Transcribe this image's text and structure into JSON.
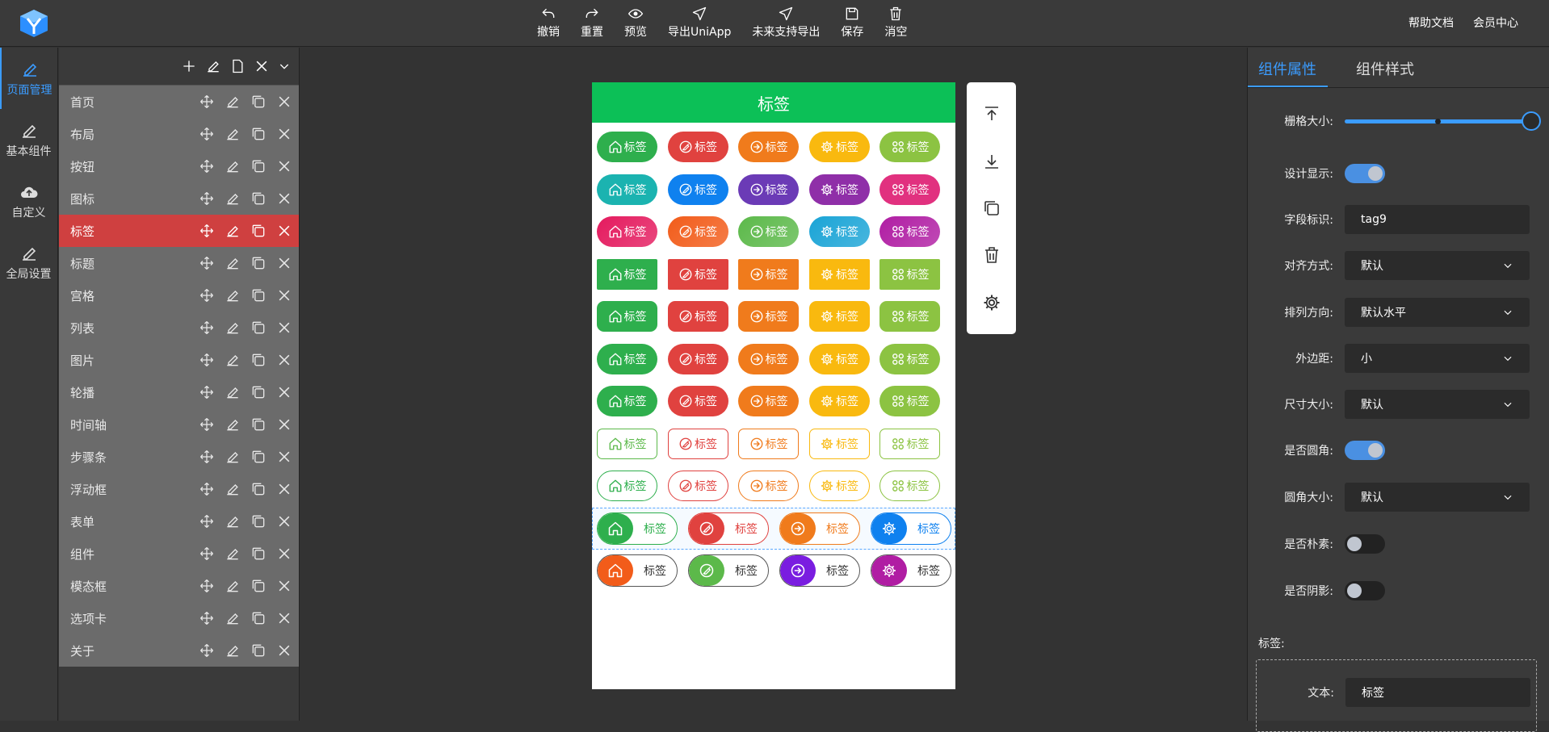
{
  "topbar": {
    "buttons": [
      {
        "label": "撤销",
        "icon": "undo-icon"
      },
      {
        "label": "重置",
        "icon": "redo-icon"
      },
      {
        "label": "预览",
        "icon": "eye-icon"
      },
      {
        "label": "导出UniApp",
        "icon": "send-icon"
      },
      {
        "label": "未来支持导出",
        "icon": "send-icon"
      },
      {
        "label": "保存",
        "icon": "save-icon"
      },
      {
        "label": "消空",
        "icon": "trash-icon"
      }
    ],
    "right_links": [
      "帮助文档",
      "会员中心"
    ]
  },
  "left_rail": {
    "items": [
      {
        "label": "页面管理",
        "icon": "edit-icon",
        "active": true
      },
      {
        "label": "基本组件",
        "icon": "edit-icon",
        "active": false
      },
      {
        "label": "自定义",
        "icon": "cloud-upload-icon",
        "active": false
      },
      {
        "label": "全局设置",
        "icon": "edit-icon",
        "active": false
      }
    ]
  },
  "page_panel": {
    "pages": [
      "首页",
      "布局",
      "按钮",
      "图标",
      "标签",
      "标题",
      "宫格",
      "列表",
      "图片",
      "轮播",
      "时间轴",
      "步骤条",
      "浮动框",
      "表单",
      "组件",
      "模态框",
      "选项卡",
      "关于"
    ],
    "active_index": 4
  },
  "canvas": {
    "title": "标签",
    "tag_label": "标签",
    "icons": [
      "home-icon",
      "no-edit-icon",
      "arrow-right-circle-icon",
      "gear-icon",
      "apps-icon"
    ],
    "row_colors": [
      [
        "#2eaf4d",
        "#e0423f",
        "#f07b1c",
        "#f9b90f",
        "#8cc342"
      ],
      [
        "#1bb3b0",
        "#0f81ef",
        "#6b3bb6",
        "#8f2fa8",
        "#e1317f"
      ],
      [
        "#e41a5e",
        "#f25c1a",
        "#5cb94a",
        "#1aa4d6",
        "#b01da3"
      ],
      [
        "#2eaf4d",
        "#e0423f",
        "#f07b1c",
        "#f9b90f",
        "#8cc342"
      ],
      [
        "#2eaf4d",
        "#e0423f",
        "#f07b1c",
        "#f9b90f",
        "#8cc342"
      ],
      [
        "#2eaf4d",
        "#e0423f",
        "#f07b1c",
        "#f9b90f",
        "#8cc342"
      ],
      [
        "#2eaf4d",
        "#e0423f",
        "#f07b1c",
        "#f9b90f",
        "#8cc342"
      ],
      [
        "#5cb94a",
        "#e0423f",
        "#f07b1c",
        "#f9b90f",
        "#8cc342"
      ],
      [
        "#2eaf4d",
        "#e0423f",
        "#f07b1c",
        "#f9b90f",
        "#8cc342"
      ]
    ],
    "split_row_1": {
      "icons": [
        "home-icon",
        "no-edit-icon",
        "arrow-right-circle-icon",
        "gear-icon"
      ],
      "colors": [
        "#2eaf4d",
        "#e0423f",
        "#f07b1c",
        "#0f81ef"
      ]
    },
    "split_row_2": {
      "icons": [
        "home-icon",
        "no-edit-icon",
        "arrow-right-circle-icon",
        "gear-icon"
      ],
      "colors": [
        "#f25c1a",
        "#5cb94a",
        "#7a1de0",
        "#b01da3"
      ]
    }
  },
  "right_panel": {
    "tabs": [
      "组件属性",
      "组件样式"
    ],
    "props": {
      "grid_size_label": "栅格大小:",
      "design_show_label": "设计显示:",
      "field_id_label": "字段标识:",
      "field_id_value": "tag9",
      "align_label": "对齐方式:",
      "align_value": "默认",
      "direction_label": "排列方向:",
      "direction_value": "默认水平",
      "margin_label": "外边距:",
      "margin_value": "小",
      "size_label": "尺寸大小:",
      "size_value": "默认",
      "rounded_label": "是否圆角:",
      "radius_label": "圆角大小:",
      "radius_value": "默认",
      "plain_label": "是否朴素:",
      "shadow_label": "是否阴影:",
      "tags_section_label": "标签:",
      "text_label": "文本:",
      "text_value": "标签"
    },
    "accent": "#3b9cff"
  }
}
